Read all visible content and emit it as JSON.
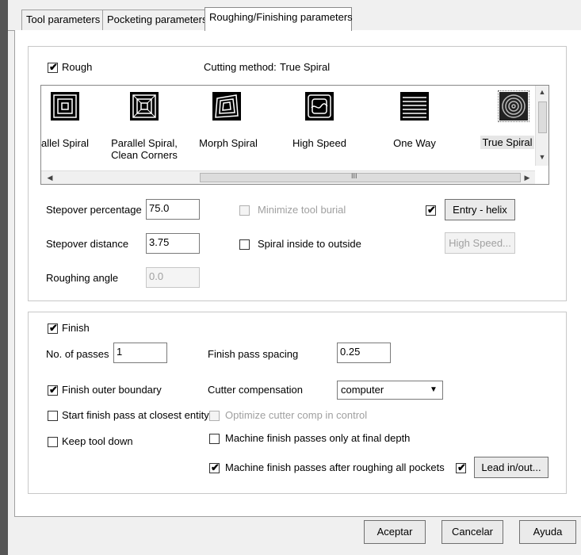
{
  "tabs": [
    {
      "label": "Tool parameters",
      "active": false
    },
    {
      "label": "Pocketing parameters",
      "active": false
    },
    {
      "label": "Roughing/Finishing parameters",
      "active": true
    }
  ],
  "rough": {
    "checkbox_label": "Rough",
    "checked": true,
    "cutting_method_label": "Cutting method:",
    "cutting_method_value": "True Spiral",
    "methods": [
      {
        "label": "allel Spiral",
        "icon": "parallel-spiral-icon"
      },
      {
        "label": "Parallel Spiral,\nClean Corners",
        "icon": "parallel-spiral-clean-corners-icon"
      },
      {
        "label": "Morph Spiral",
        "icon": "morph-spiral-icon"
      },
      {
        "label": "High Speed",
        "icon": "high-speed-icon"
      },
      {
        "label": "One Way",
        "icon": "one-way-icon"
      },
      {
        "label": "True Spiral",
        "icon": "true-spiral-icon",
        "selected": true
      }
    ],
    "hscroll_mid": "III",
    "stepover_percentage_label": "Stepover percentage",
    "stepover_percentage_value": "75.0",
    "stepover_distance_label": "Stepover distance",
    "stepover_distance_value": "3.75",
    "roughing_angle_label": "Roughing angle",
    "roughing_angle_value": "0.0",
    "minimize_tool_burial_label": "Minimize tool burial",
    "spiral_inside_to_outside_label": "Spiral inside to outside",
    "entry_helix_button": "Entry - helix",
    "high_speed_button": "High Speed..."
  },
  "finish": {
    "checkbox_label": "Finish",
    "no_of_passes_label": "No. of passes",
    "no_of_passes_value": "1",
    "finish_pass_spacing_label": "Finish pass spacing",
    "finish_pass_spacing_value": "0.25",
    "finish_outer_boundary_label": "Finish outer boundary",
    "cutter_compensation_label": "Cutter compensation",
    "cutter_compensation_value": "computer",
    "start_finish_pass_label": "Start finish pass at closest entity",
    "optimize_cutter_comp_label": "Optimize cutter comp in control",
    "keep_tool_down_label": "Keep tool down",
    "machine_final_depth_label": "Machine finish passes only at final depth",
    "machine_after_roughing_label": "Machine finish passes after roughing all pockets",
    "lead_inout_button": "Lead in/out..."
  },
  "buttons": {
    "ok": "Aceptar",
    "cancel": "Cancelar",
    "help": "Ayuda"
  },
  "check_mark": "✔"
}
